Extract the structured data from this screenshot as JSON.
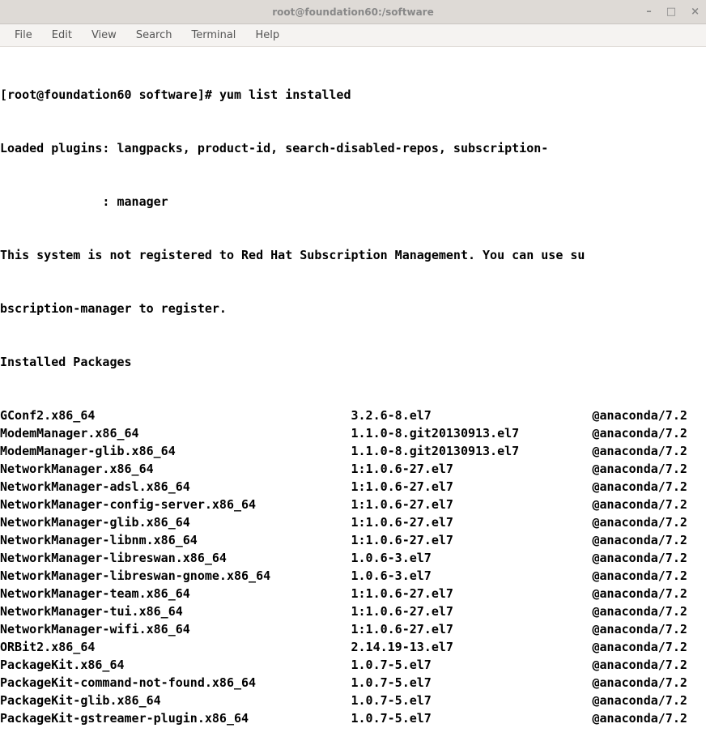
{
  "window": {
    "title": "root@foundation60:/software"
  },
  "menubar": {
    "items": [
      "File",
      "Edit",
      "View",
      "Search",
      "Terminal",
      "Help"
    ]
  },
  "terminal": {
    "prompt": "[root@foundation60 software]# ",
    "command": "yum list installed",
    "lines": [
      "Loaded plugins: langpacks, product-id, search-disabled-repos, subscription-",
      "              : manager",
      "This system is not registered to Red Hat Subscription Management. You can use su",
      "bscription-manager to register.",
      "Installed Packages"
    ],
    "packages": [
      {
        "name": "GConf2.x86_64",
        "version": "3.2.6-8.el7",
        "repo": "@anaconda/7.2"
      },
      {
        "name": "ModemManager.x86_64",
        "version": "1.1.0-8.git20130913.el7",
        "repo": "@anaconda/7.2"
      },
      {
        "name": "ModemManager-glib.x86_64",
        "version": "1.1.0-8.git20130913.el7",
        "repo": "@anaconda/7.2"
      },
      {
        "name": "NetworkManager.x86_64",
        "version": "1:1.0.6-27.el7",
        "repo": "@anaconda/7.2"
      },
      {
        "name": "NetworkManager-adsl.x86_64",
        "version": "1:1.0.6-27.el7",
        "repo": "@anaconda/7.2"
      },
      {
        "name": "NetworkManager-config-server.x86_64",
        "version": "1:1.0.6-27.el7",
        "repo": "@anaconda/7.2"
      },
      {
        "name": "NetworkManager-glib.x86_64",
        "version": "1:1.0.6-27.el7",
        "repo": "@anaconda/7.2"
      },
      {
        "name": "NetworkManager-libnm.x86_64",
        "version": "1:1.0.6-27.el7",
        "repo": "@anaconda/7.2"
      },
      {
        "name": "NetworkManager-libreswan.x86_64",
        "version": "1.0.6-3.el7",
        "repo": "@anaconda/7.2"
      },
      {
        "name": "NetworkManager-libreswan-gnome.x86_64",
        "version": "1.0.6-3.el7",
        "repo": "@anaconda/7.2"
      },
      {
        "name": "NetworkManager-team.x86_64",
        "version": "1:1.0.6-27.el7",
        "repo": "@anaconda/7.2"
      },
      {
        "name": "NetworkManager-tui.x86_64",
        "version": "1:1.0.6-27.el7",
        "repo": "@anaconda/7.2"
      },
      {
        "name": "NetworkManager-wifi.x86_64",
        "version": "1:1.0.6-27.el7",
        "repo": "@anaconda/7.2"
      },
      {
        "name": "ORBit2.x86_64",
        "version": "2.14.19-13.el7",
        "repo": "@anaconda/7.2"
      },
      {
        "name": "PackageKit.x86_64",
        "version": "1.0.7-5.el7",
        "repo": "@anaconda/7.2"
      },
      {
        "name": "PackageKit-command-not-found.x86_64",
        "version": "1.0.7-5.el7",
        "repo": "@anaconda/7.2"
      },
      {
        "name": "PackageKit-glib.x86_64",
        "version": "1.0.7-5.el7",
        "repo": "@anaconda/7.2"
      },
      {
        "name": "PackageKit-gstreamer-plugin.x86_64",
        "version": "1.0.7-5.el7",
        "repo": "@anaconda/7.2"
      }
    ],
    "col_name_width": 48,
    "col_version_width": 33
  }
}
